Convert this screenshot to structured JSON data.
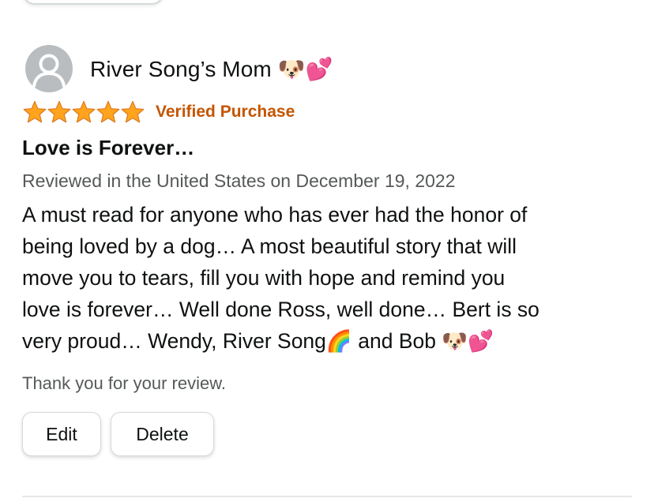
{
  "review": {
    "reviewer_name": "River Song’s Mom 🐶💕",
    "rating": 5,
    "rating_max": 5,
    "verified_label": "Verified Purchase",
    "title": "Love is Forever…",
    "date_line": "Reviewed in the United States on December 19, 2022",
    "body_lines": [
      "A must read for anyone who has ever had the honor of",
      "being loved by a dog… A most beautiful story that will",
      "move you to tears, fill you with hope and remind you",
      "love is forever… Well done Ross, well done… Bert is so",
      "very proud… Wendy, River Song🌈 and Bob 🐶💕"
    ]
  },
  "thanks_text": "Thank you for your review.",
  "actions": {
    "edit_label": "Edit",
    "delete_label": "Delete"
  },
  "colors": {
    "star": "#ffa41c",
    "verified": "#c45500",
    "secondary_text": "#565959",
    "avatar_bg": "#b9bdc0"
  },
  "icons": {
    "avatar": "user-avatar-icon",
    "star": "star-icon"
  }
}
